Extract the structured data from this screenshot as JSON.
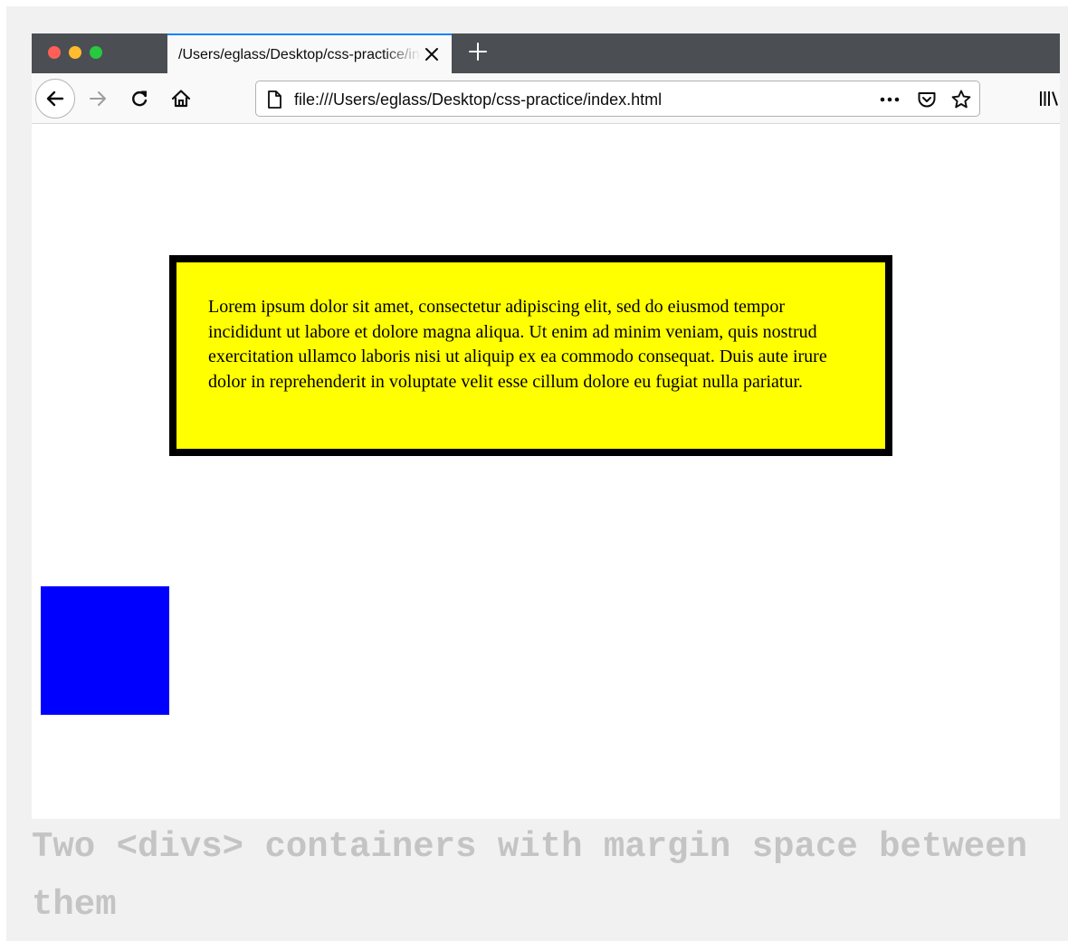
{
  "browser": {
    "tab": {
      "title": "/Users/eglass/Desktop/css-practice/index.html"
    },
    "urlbar": {
      "url": "file:///Users/eglass/Desktop/css-practice/index.html"
    },
    "icons": {
      "close": "close-icon",
      "new_tab": "plus-icon",
      "back": "back-arrow-icon",
      "forward": "forward-arrow-icon",
      "reload": "reload-icon",
      "home": "home-icon",
      "page": "page-icon",
      "more": "more-icon",
      "pocket": "pocket-icon",
      "bookmark": "star-icon",
      "library": "library-icon"
    },
    "traffic_lights": {
      "close_color": "#fe5f57",
      "minimize_color": "#febc2e",
      "zoom_color": "#28c840"
    }
  },
  "page": {
    "yellow_box": {
      "text": "Lorem ipsum dolor sit amet, consectetur adipiscing elit, sed do eiusmod tempor incididunt ut labore et dolore magna aliqua. Ut enim ad minim veniam, quis nostrud exercitation ullamco laboris nisi ut aliquip ex ea commodo consequat. Duis aute irure dolor in reprehenderit in voluptate velit esse cillum dolore eu fugiat nulla pariatur.",
      "background": "#ffff00",
      "border_color": "#000000"
    },
    "blue_box": {
      "background": "#0000ff"
    }
  },
  "caption": {
    "text": "Two <divs> containers with margin space between them"
  }
}
